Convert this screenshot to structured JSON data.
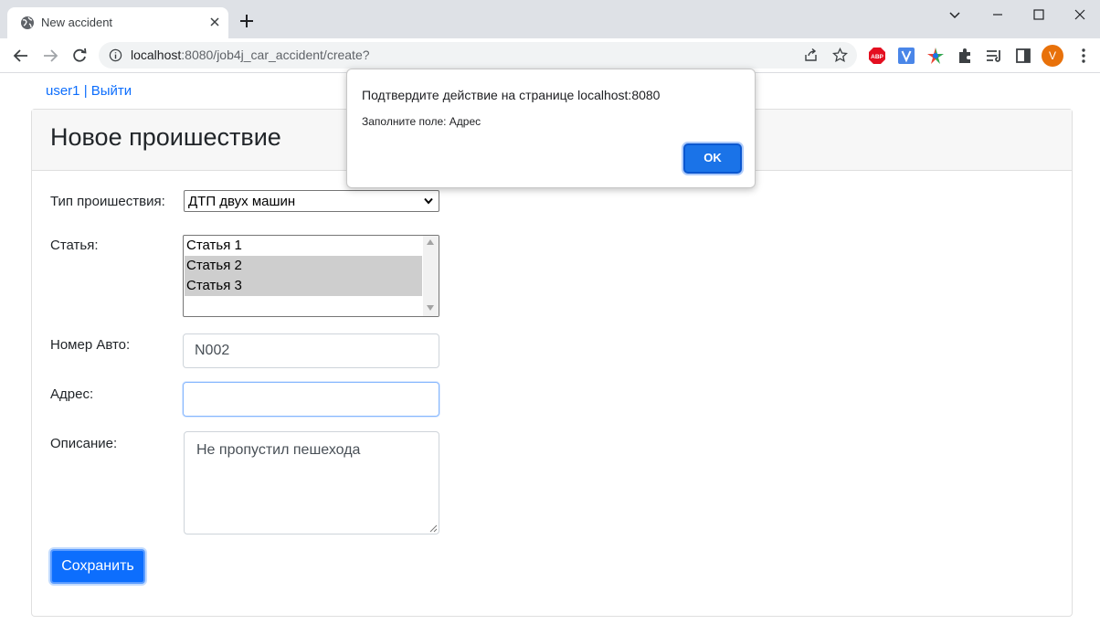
{
  "browser": {
    "tab_title": "New accident",
    "url_host": "localhost",
    "url_rest": ":8080/job4j_car_accident/create?",
    "avatar_letter": "V",
    "avatar_color": "#e8710a",
    "icons": [
      "back-icon",
      "forward-icon",
      "reload-icon",
      "info-icon",
      "share-icon",
      "bookmark-star-icon",
      "adblock-icon",
      "v-extension-icon",
      "color-extension-icon",
      "extensions-puzzle-icon",
      "reading-list-icon",
      "side-panel-icon",
      "menu-dots-icon"
    ]
  },
  "page": {
    "user_link": "user1",
    "separator": " | ",
    "logout_link": "Выйти",
    "title": "Новое проишествие",
    "labels": {
      "type": "Тип проишествия:",
      "article": "Статья:",
      "car_number": "Номер Авто:",
      "address": "Адрес:",
      "description": "Описание:"
    },
    "type_selected": "ДТП двух машин",
    "articles": [
      {
        "label": "Статья 1",
        "selected": false
      },
      {
        "label": "Статья 2",
        "selected": true
      },
      {
        "label": "Статья 3",
        "selected": true
      }
    ],
    "car_number_value": "N002",
    "address_value": "",
    "description_value": "Не пропустил пешехода",
    "save_label": "Сохранить",
    "accent_color": "#0d6efd"
  },
  "dialog": {
    "title": "Подтвердите действие на странице localhost:8080",
    "message": "Заполните поле: Адрес",
    "ok_label": "OK"
  }
}
